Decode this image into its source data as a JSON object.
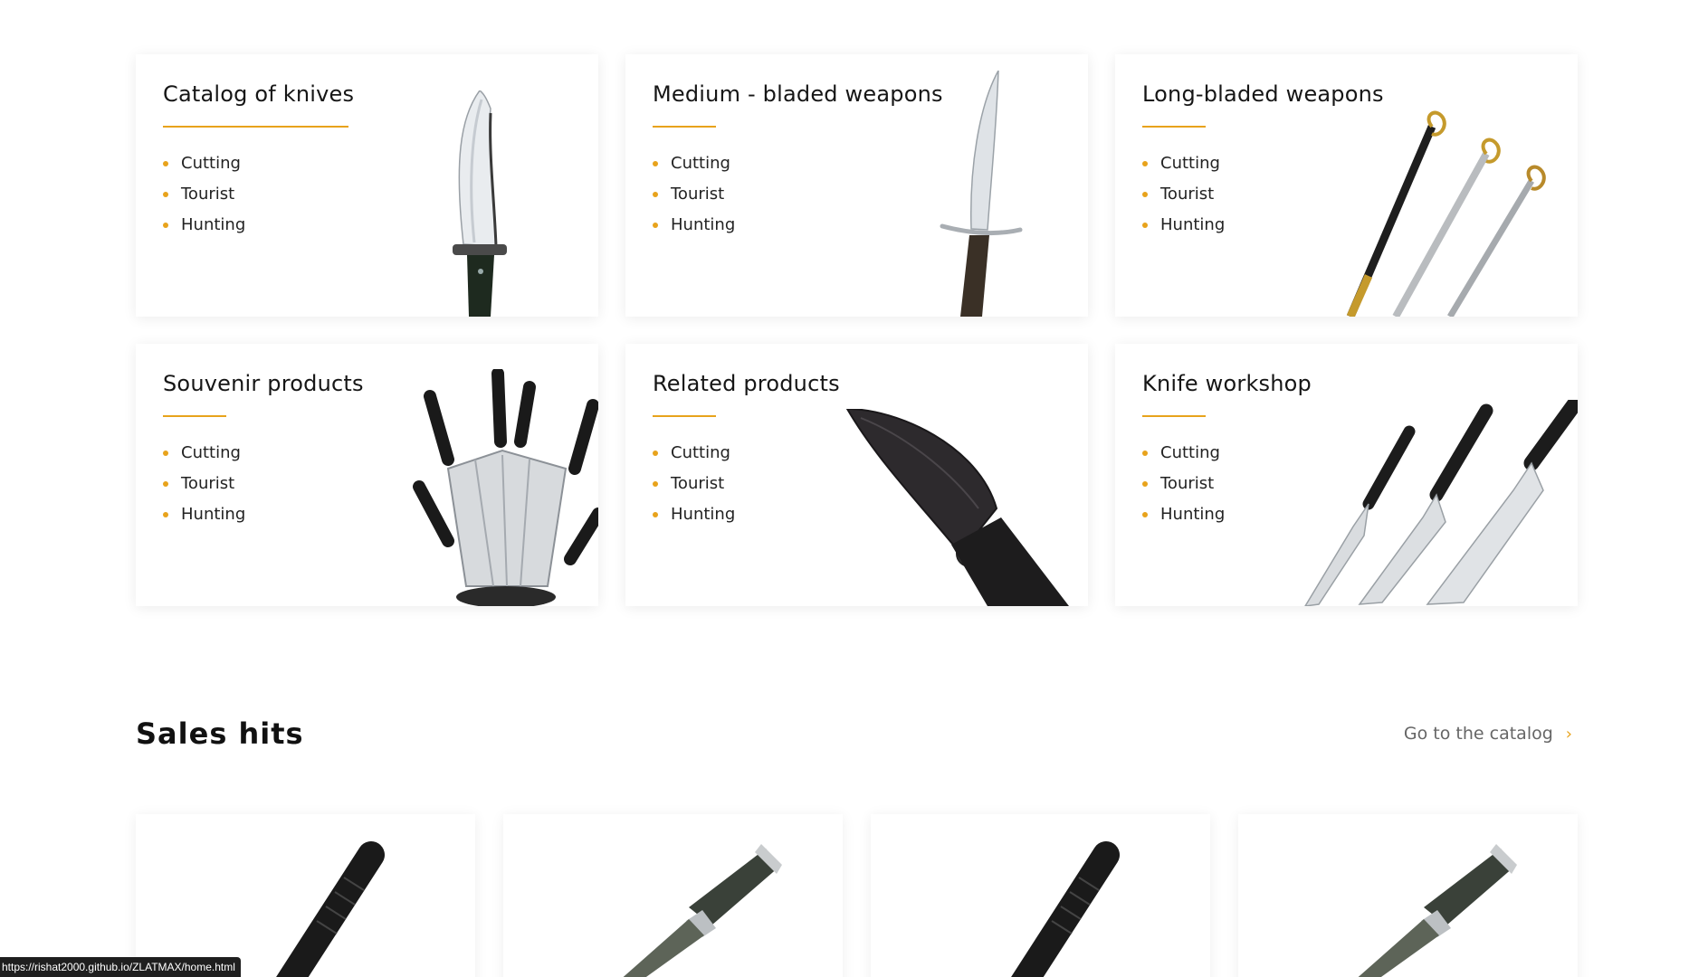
{
  "categories": [
    {
      "title": "Catalog of knives",
      "items": [
        "Cutting",
        "Tourist",
        "Hunting"
      ],
      "image": "bowie-knife-image"
    },
    {
      "title": "Medium - bladed weapons",
      "items": [
        "Cutting",
        "Tourist",
        "Hunting"
      ],
      "image": "dagger-image"
    },
    {
      "title": "Long-bladed weapons",
      "items": [
        "Cutting",
        "Tourist",
        "Hunting"
      ],
      "image": "sabers-image"
    },
    {
      "title": "Souvenir products",
      "items": [
        "Cutting",
        "Tourist",
        "Hunting"
      ],
      "image": "knife-block-image"
    },
    {
      "title": "Related products",
      "items": [
        "Cutting",
        "Tourist",
        "Hunting"
      ],
      "image": "sheath-image"
    },
    {
      "title": "Knife workshop",
      "items": [
        "Cutting",
        "Tourist",
        "Hunting"
      ],
      "image": "kitchen-knives-image"
    }
  ],
  "sales_hits": {
    "title": "Sales hits",
    "catalog_link": "Go to the catalog",
    "link_icon": "chevron-right-icon",
    "products": [
      {
        "image": "black-handle-knife-image"
      },
      {
        "image": "leather-handle-knife-image"
      },
      {
        "image": "black-handle-knife-image"
      },
      {
        "image": "leather-handle-knife-image"
      }
    ]
  },
  "status_bar": {
    "url": "https://rishat2000.github.io/ZLATMAX/home.html"
  },
  "colors": {
    "accent": "#e8a31c",
    "text": "#161616",
    "link": "#666666"
  }
}
